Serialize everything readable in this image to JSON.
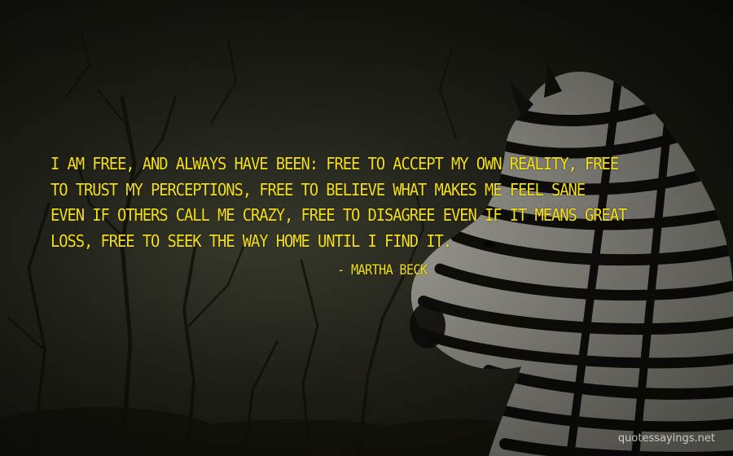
{
  "quote": {
    "lines": [
      "I AM FREE, AND ALWAYS HAVE BEEN: FREE TO ACCEPT MY OWN REALITY, FREE",
      "TO TRUST MY PERCEPTIONS, FREE TO BELIEVE WHAT MAKES ME FEEL SANE",
      "EVEN IF OTHERS CALL ME CRAZY, FREE TO DISAGREE EVEN IF IT MEANS GREAT",
      "LOSS, FREE TO SEEK THE WAY HOME UNTIL I FIND IT."
    ],
    "author": "- MARTHA BECK",
    "text_color": "#f3df16"
  },
  "watermark": "quotessayings.net",
  "scene": {
    "subject": "zebra-icon",
    "background": "trees-icon"
  }
}
